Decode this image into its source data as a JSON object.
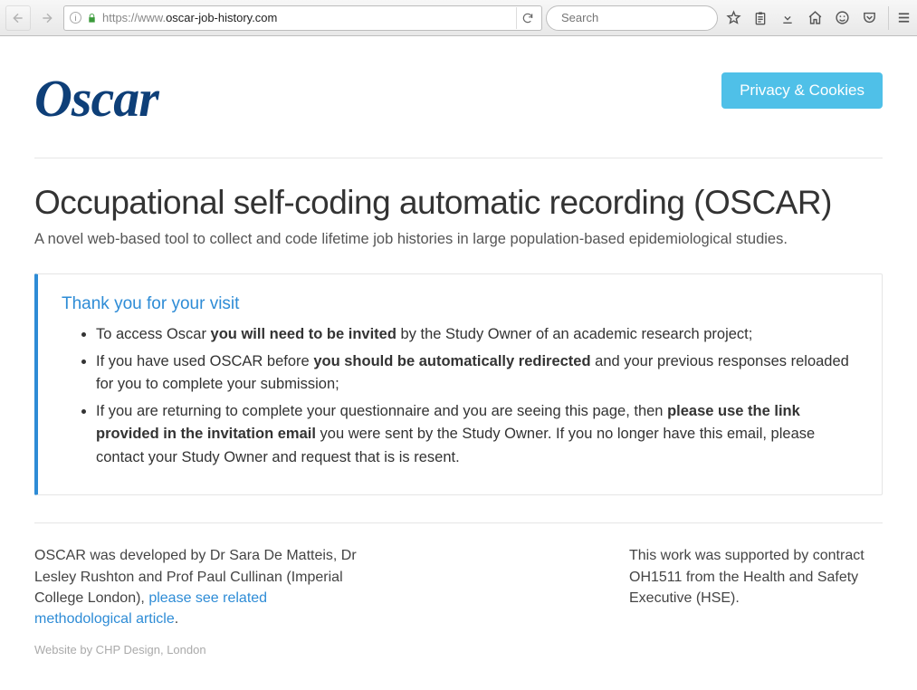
{
  "browser": {
    "url_prefix": "https://www.",
    "url_bold": "oscar-job-history.com",
    "search_placeholder": "Search"
  },
  "header": {
    "logo": "Oscar",
    "privacy_label": "Privacy & Cookies"
  },
  "main": {
    "title": "Occupational self-coding automatic recording (OSCAR)",
    "subtitle": "A novel web-based tool to collect and code lifetime job histories in large population-based epidemiological studies."
  },
  "notice": {
    "heading": "Thank you for your visit",
    "items": [
      {
        "pre": "To access Oscar ",
        "bold": "you will need to be invited",
        "post": " by the Study Owner of an academic research project;"
      },
      {
        "pre": "If you have used OSCAR before ",
        "bold": "you should be automatically redirected",
        "post": " and your previous responses reloaded for you to complete your submission;"
      },
      {
        "pre": "If you are returning to complete your questionnaire and you are seeing this page, then ",
        "bold": "please use the link provided in the invitation email",
        "post": " you were sent by the Study Owner. If you no longer have this email, please contact your Study Owner and request that is is resent."
      }
    ]
  },
  "footer": {
    "left_pre": "OSCAR was developed by Dr Sara De Matteis, Dr Lesley Rushton and Prof Paul Cullinan (Imperial College London), ",
    "left_link": "please see related methodological article",
    "left_post": ".",
    "right": "This work was supported by contract OH1511 from the Health and Safety Executive (HSE).",
    "credit": "Website by CHP Design, London"
  }
}
